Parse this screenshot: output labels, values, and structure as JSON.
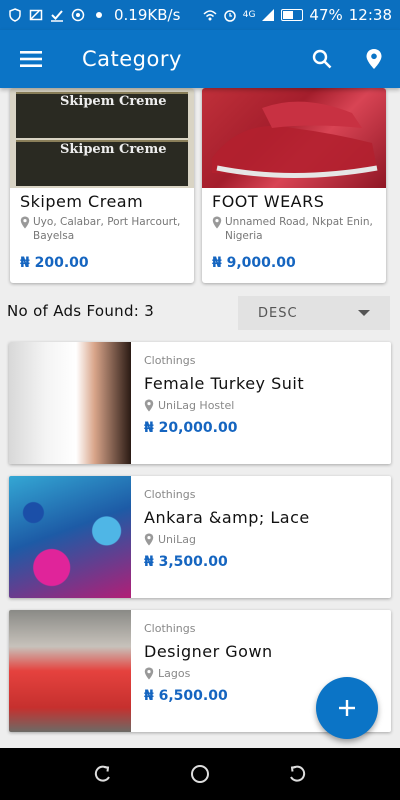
{
  "status_bar": {
    "speed": "0.19KB/s",
    "network": "4G",
    "battery": "47%",
    "battery_level": 0.47,
    "time": "12:38"
  },
  "app_bar": {
    "title": "Category"
  },
  "featured": [
    {
      "name": "Skipem Cream",
      "location": "Uyo, Calabar, Port Harcourt, Bayelsa",
      "price": "₦ 200.00",
      "image_text": "Skipem Creme"
    },
    {
      "name": "FOOT WEARS",
      "location": "Unnamed Road, Nkpat Enin, Nigeria",
      "price": "₦ 9,000.00"
    }
  ],
  "results": {
    "count_label": "No of Ads Found: 3",
    "sort_value": "DESC"
  },
  "listings": [
    {
      "category": "Clothings",
      "title": "Female Turkey Suit",
      "location": "UniLag Hostel",
      "price": "₦ 20,000.00"
    },
    {
      "category": "Clothings",
      "title": "Ankara &amp; Lace",
      "location": "UniLag",
      "price": "₦ 3,500.00"
    },
    {
      "category": "Clothings",
      "title": "Designer Gown",
      "location": "Lagos",
      "price": "₦ 6,500.00"
    }
  ],
  "colors": {
    "primary": "#0b74c6",
    "price": "#1565c0"
  },
  "icons": {
    "menu": "hamburger-menu-icon",
    "search": "search-icon",
    "location": "map-pin-icon",
    "fab": "plus-icon"
  }
}
